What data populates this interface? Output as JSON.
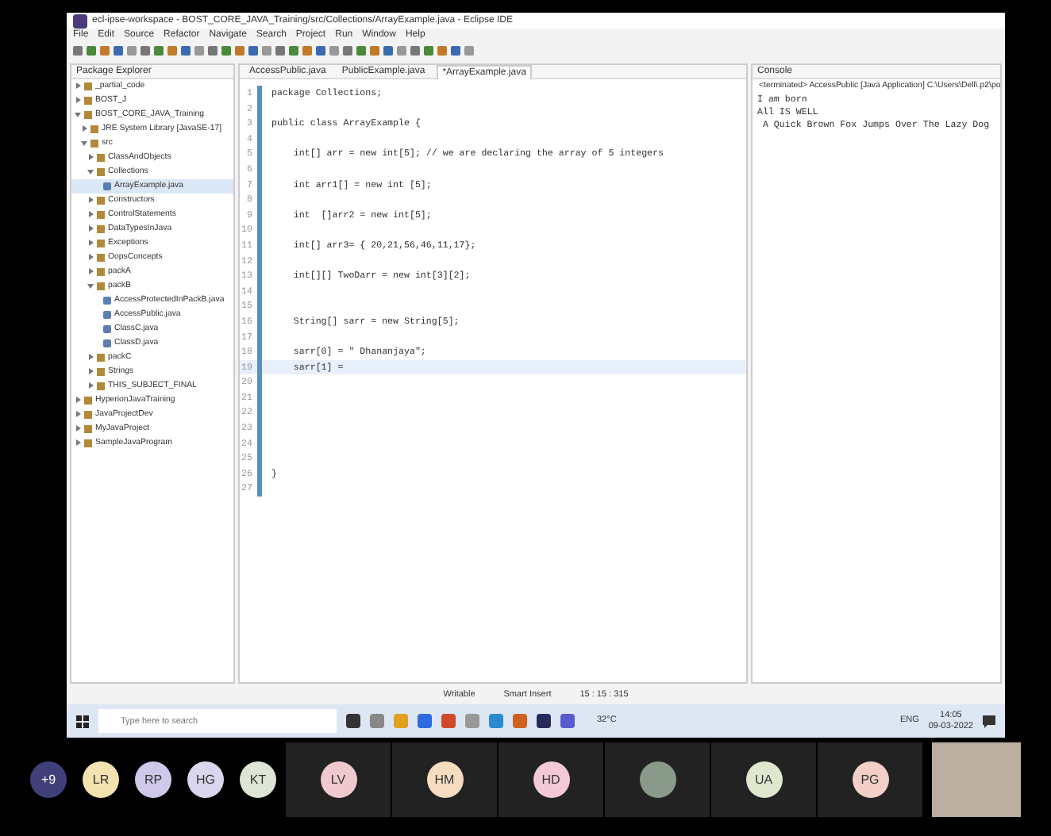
{
  "window": {
    "title": "ecl-ipse-workspace - BOST_CORE_JAVA_Training/src/Collections/ArrayExample.java - Eclipse IDE"
  },
  "menu": [
    "File",
    "Edit",
    "Source",
    "Refactor",
    "Navigate",
    "Search",
    "Project",
    "Run",
    "Window",
    "Help"
  ],
  "package_explorer": {
    "title": "Package Explorer",
    "items": [
      {
        "label": "_partial_code",
        "expanded": false
      },
      {
        "label": "BOST_J",
        "expanded": false
      },
      {
        "label": "BOST_CORE_JAVA_Training",
        "expanded": true,
        "children": [
          {
            "label": "JRE System Library [JavaSE-17]",
            "expanded": false
          },
          {
            "label": "src",
            "expanded": true,
            "children": [
              {
                "label": "ClassAndObjects",
                "expanded": false
              },
              {
                "label": "Collections",
                "expanded": true,
                "children": [
                  {
                    "label": "ArrayExample.java",
                    "selected": true
                  }
                ]
              },
              {
                "label": "Constructors",
                "expanded": false
              },
              {
                "label": "ControlStatements",
                "expanded": false
              },
              {
                "label": "DataTypesInJava",
                "expanded": false
              },
              {
                "label": "Exceptions",
                "expanded": false
              },
              {
                "label": "OopsConcepts",
                "expanded": false
              },
              {
                "label": "packA",
                "expanded": false
              },
              {
                "label": "packB",
                "expanded": true,
                "children": [
                  {
                    "label": "AccessProtectedInPackB.java",
                    "selected": false
                  },
                  {
                    "label": "AccessPublic.java",
                    "selected": false
                  },
                  {
                    "label": "ClassC.java",
                    "selected": false
                  },
                  {
                    "label": "ClassD.java",
                    "selected": false
                  }
                ]
              },
              {
                "label": "packC",
                "expanded": false
              },
              {
                "label": "Strings",
                "expanded": false
              },
              {
                "label": "THIS_SUBJECT_FINAL",
                "expanded": false
              }
            ]
          }
        ]
      },
      {
        "label": "HyperionJavaTraining",
        "expanded": false
      },
      {
        "label": "JavaProjectDev",
        "expanded": false
      },
      {
        "label": "MyJavaProject",
        "expanded": false
      },
      {
        "label": "SampleJavaProgram",
        "expanded": false
      }
    ]
  },
  "editor": {
    "tabs": [
      {
        "label": "AccessPublic.java",
        "selected": false
      },
      {
        "label": "PublicExample.java",
        "selected": false
      },
      {
        "label": "*ArrayExample.java",
        "selected": true
      }
    ],
    "lines": [
      {
        "number": "1",
        "code": "package Collections;"
      },
      {
        "number": "2"
      },
      {
        "number": "3",
        "code": "public class ArrayExample {"
      },
      {
        "number": "4"
      },
      {
        "number": "5",
        "code": "    int[] arr = new int[5]; // we are declaring the array of 5 integers"
      },
      {
        "number": "6"
      },
      {
        "number": "7",
        "code": "    int arr1[] = new int [5];"
      },
      {
        "number": "8"
      },
      {
        "number": "9",
        "code": "    int  []arr2 = new int[5];"
      },
      {
        "number": "10"
      },
      {
        "number": "11",
        "code": "    int[] arr3= { 20,21,56,46,11,17};"
      },
      {
        "number": "12"
      },
      {
        "number": "13",
        "code": "    int[][] TwoDarr = new int[3][2];"
      },
      {
        "number": "14"
      },
      {
        "number": "15"
      },
      {
        "number": "16",
        "code": "    String[] sarr = new String[5];"
      },
      {
        "number": "17"
      },
      {
        "number": "18",
        "code": "    sarr[0] = \" Dhananjaya\";"
      },
      {
        "number": "19",
        "code": "    sarr[1] =",
        "current": true
      },
      {
        "number": "20"
      },
      {
        "number": "21"
      },
      {
        "number": "22"
      },
      {
        "number": "23"
      },
      {
        "number": "24"
      },
      {
        "number": "25"
      },
      {
        "number": "26",
        "code": "}"
      },
      {
        "number": "27"
      }
    ]
  },
  "console": {
    "title": "Console",
    "header": "<terminated> AccessPublic [Java Application] C:\\Users\\Dell\\.p2\\po",
    "output": [
      "I am born",
      "All IS WELL",
      " A Quick Brown Fox Jumps Over The Lazy Dog"
    ]
  },
  "status_bar": [
    "Writable",
    "Smart Insert",
    "15 : 15 : 315"
  ],
  "taskbar": {
    "search": {
      "placeholder": "Type here to search"
    },
    "weather": "32°C",
    "language": "ENG",
    "time": "14:05",
    "date": "09-03-2022"
  },
  "participants": [
    {
      "initials": "+9",
      "color": "#3f3f7a",
      "kind": "avatar"
    },
    {
      "initials": "LR",
      "color": "#f3e3b0",
      "kind": "avatar"
    },
    {
      "initials": "RP",
      "color": "#cfc8ea",
      "kind": "avatar"
    },
    {
      "initials": "HG",
      "color": "#d9d6ee",
      "kind": "avatar"
    },
    {
      "initials": "KT",
      "color": "#dde6d6",
      "kind": "avatar"
    },
    {
      "initials": "LV",
      "color": "#f0c9cf",
      "kind": "tile"
    },
    {
      "initials": "HM",
      "color": "#f6dcc0",
      "kind": "tile"
    },
    {
      "initials": "HD",
      "color": "#f3c8d8",
      "kind": "tile"
    },
    {
      "kind": "photo"
    },
    {
      "initials": "UA",
      "color": "#dfe8cf",
      "kind": "tile"
    },
    {
      "initials": "PG",
      "color": "#f3cfc7",
      "kind": "tile"
    },
    {
      "kind": "video"
    }
  ]
}
